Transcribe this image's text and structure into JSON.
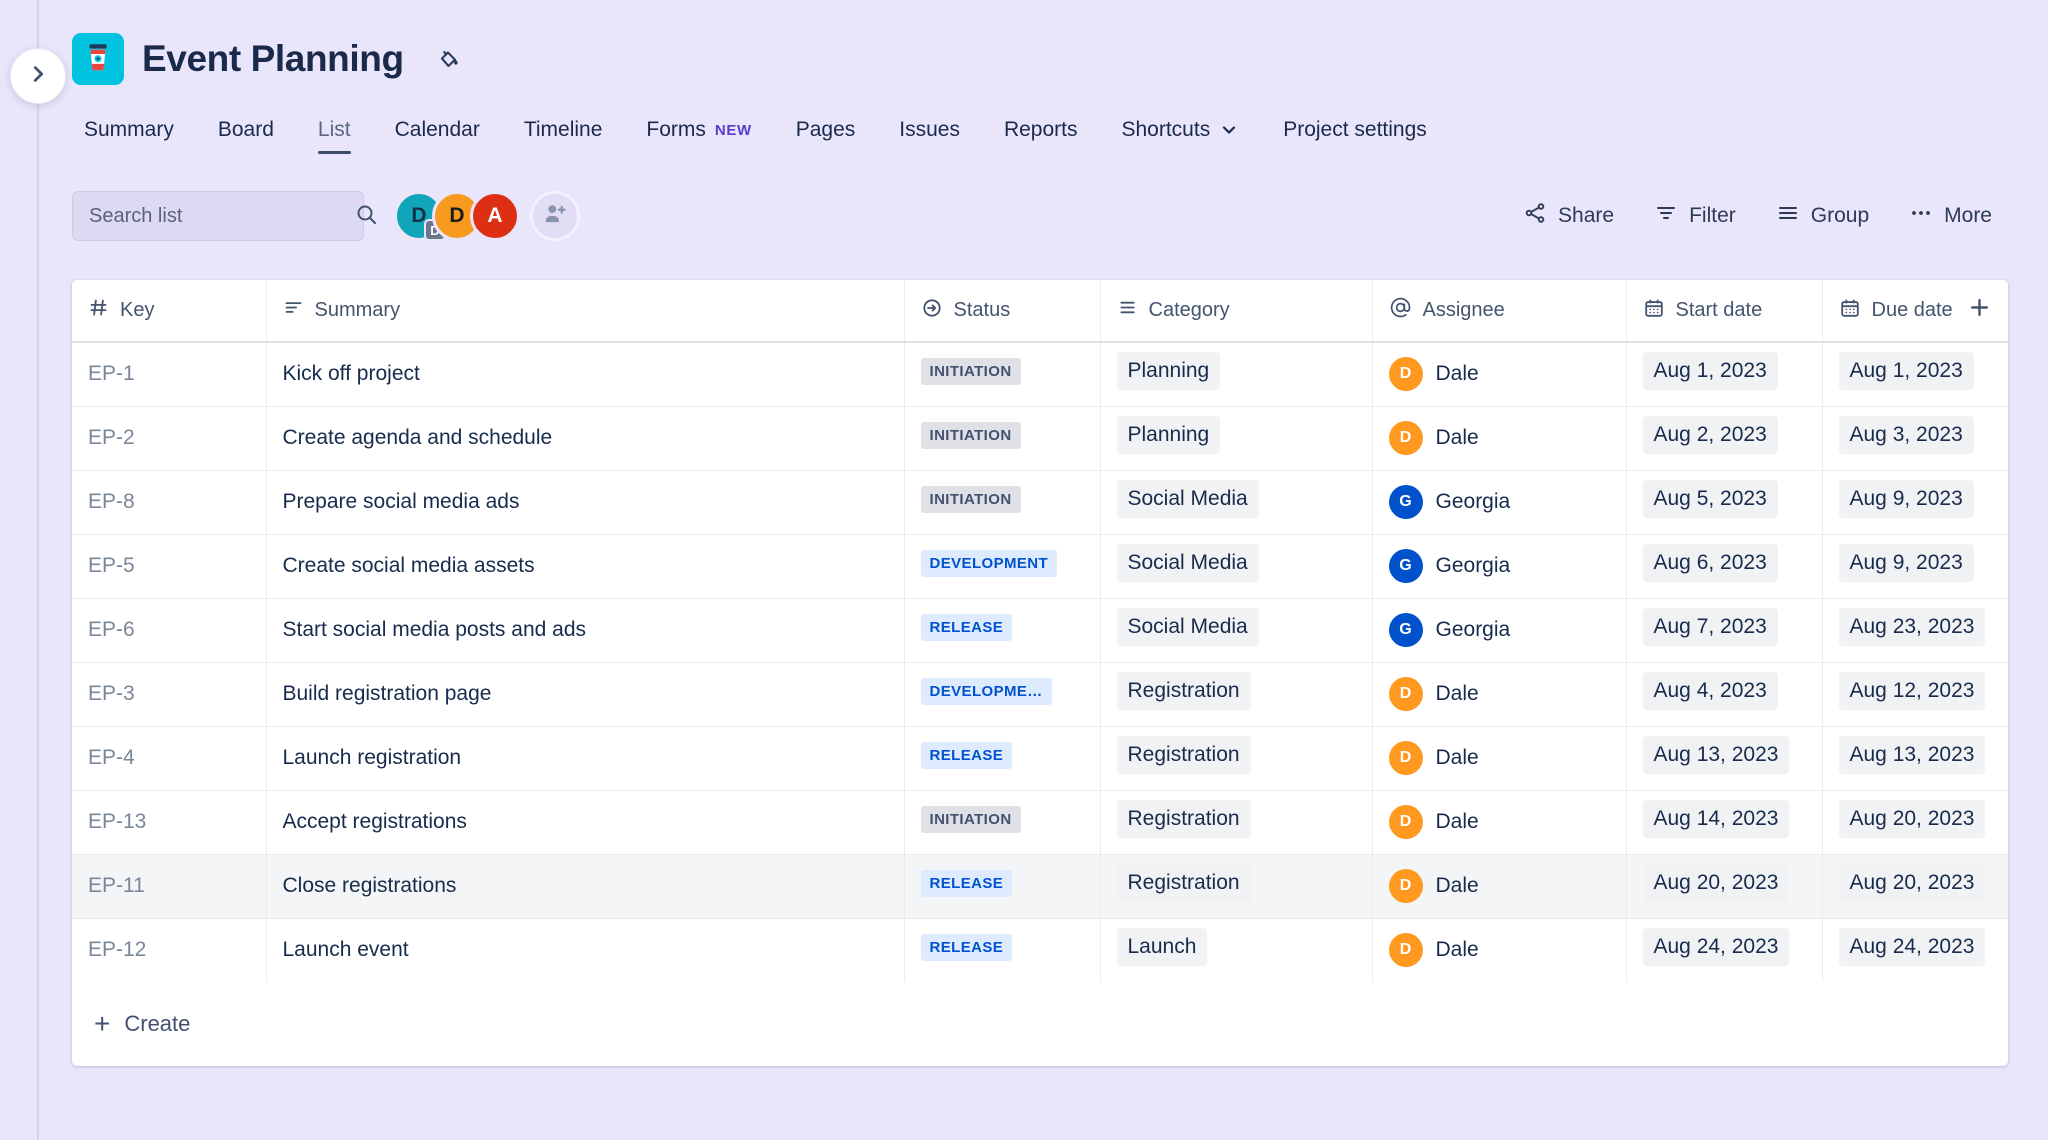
{
  "rail": {
    "expand_icon": "chevron-right-icon"
  },
  "header": {
    "project_icon": "coffee-cup-icon",
    "project_icon_bg": "#00c3e0",
    "title": "Event Planning",
    "paint_icon": "paint-bucket-icon"
  },
  "tabs": [
    {
      "label": "Summary",
      "active": false
    },
    {
      "label": "Board",
      "active": false
    },
    {
      "label": "List",
      "active": true
    },
    {
      "label": "Calendar",
      "active": false
    },
    {
      "label": "Timeline",
      "active": false
    },
    {
      "label": "Forms",
      "active": false,
      "badge": "NEW"
    },
    {
      "label": "Pages",
      "active": false
    },
    {
      "label": "Issues",
      "active": false
    },
    {
      "label": "Reports",
      "active": false
    },
    {
      "label": "Shortcuts",
      "active": false,
      "chevron": "chevron-down-icon"
    },
    {
      "label": "Project settings",
      "active": false
    }
  ],
  "toolbar": {
    "search": {
      "placeholder": "Search list",
      "value": "",
      "icon": "search-icon"
    },
    "avatars": [
      {
        "initial": "D",
        "color": "#12a4b8",
        "sub_initial": "D"
      },
      {
        "initial": "D",
        "color": "#f79a1e"
      },
      {
        "initial": "A",
        "color": "#dd3013"
      }
    ],
    "add_people_icon": "add-person-icon",
    "actions": [
      {
        "label": "Share",
        "icon": "share-icon"
      },
      {
        "label": "Filter",
        "icon": "filter-icon"
      },
      {
        "label": "Group",
        "icon": "group-lines-icon"
      },
      {
        "label": "More",
        "icon": "ellipsis-icon"
      }
    ]
  },
  "table": {
    "columns": [
      {
        "label": "Key",
        "icon": "hash-icon"
      },
      {
        "label": "Summary",
        "icon": "text-lines-icon"
      },
      {
        "label": "Status",
        "icon": "arrow-circle-icon"
      },
      {
        "label": "Category",
        "icon": "list-lines-icon"
      },
      {
        "label": "Assignee",
        "icon": "at-icon"
      },
      {
        "label": "Start date",
        "icon": "calendar-icon"
      },
      {
        "label": "Due date",
        "icon": "calendar-icon"
      }
    ],
    "add_column_icon": "plus-icon",
    "rows": [
      {
        "key": "EP-1",
        "summary": "Kick off project",
        "status": "INITIATION",
        "status_tone": "gray",
        "category": "Planning",
        "assignee": "Dale",
        "assignee_initial": "D",
        "assignee_color": "#ff991f",
        "start": "Aug 1, 2023",
        "due": "Aug 1, 2023",
        "highlight": false
      },
      {
        "key": "EP-2",
        "summary": "Create agenda and schedule",
        "status": "INITIATION",
        "status_tone": "gray",
        "category": "Planning",
        "assignee": "Dale",
        "assignee_initial": "D",
        "assignee_color": "#ff991f",
        "start": "Aug 2, 2023",
        "due": "Aug 3, 2023",
        "highlight": false
      },
      {
        "key": "EP-8",
        "summary": "Prepare social media ads",
        "status": "INITIATION",
        "status_tone": "gray",
        "category": "Social Media",
        "assignee": "Georgia",
        "assignee_initial": "G",
        "assignee_color": "#0052cc",
        "start": "Aug 5, 2023",
        "due": "Aug 9, 2023",
        "highlight": false
      },
      {
        "key": "EP-5",
        "summary": "Create social media assets",
        "status": "DEVELOPMENT",
        "status_tone": "blue",
        "category": "Social Media",
        "assignee": "Georgia",
        "assignee_initial": "G",
        "assignee_color": "#0052cc",
        "start": "Aug 6, 2023",
        "due": "Aug 9, 2023",
        "highlight": false
      },
      {
        "key": "EP-6",
        "summary": "Start social media posts and ads",
        "status": "RELEASE",
        "status_tone": "blue",
        "category": "Social Media",
        "assignee": "Georgia",
        "assignee_initial": "G",
        "assignee_color": "#0052cc",
        "start": "Aug 7, 2023",
        "due": "Aug 23, 2023",
        "highlight": false
      },
      {
        "key": "EP-3",
        "summary": "Build registration page",
        "status": "DEVELOPME…",
        "status_tone": "blue",
        "category": "Registration",
        "assignee": "Dale",
        "assignee_initial": "D",
        "assignee_color": "#ff991f",
        "start": "Aug 4, 2023",
        "due": "Aug 12, 2023",
        "highlight": false
      },
      {
        "key": "EP-4",
        "summary": "Launch registration",
        "status": "RELEASE",
        "status_tone": "blue",
        "category": "Registration",
        "assignee": "Dale",
        "assignee_initial": "D",
        "assignee_color": "#ff991f",
        "start": "Aug 13, 2023",
        "due": "Aug 13, 2023",
        "highlight": false
      },
      {
        "key": "EP-13",
        "summary": "Accept registrations",
        "status": "INITIATION",
        "status_tone": "gray",
        "category": "Registration",
        "assignee": "Dale",
        "assignee_initial": "D",
        "assignee_color": "#ff991f",
        "start": "Aug 14, 2023",
        "due": "Aug 20, 2023",
        "highlight": false
      },
      {
        "key": "EP-11",
        "summary": "Close registrations",
        "status": "RELEASE",
        "status_tone": "blue",
        "category": "Registration",
        "assignee": "Dale",
        "assignee_initial": "D",
        "assignee_color": "#ff991f",
        "start": "Aug 20, 2023",
        "due": "Aug 20, 2023",
        "highlight": true
      },
      {
        "key": "EP-12",
        "summary": "Launch event",
        "status": "RELEASE",
        "status_tone": "blue",
        "category": "Launch",
        "assignee": "Dale",
        "assignee_initial": "D",
        "assignee_color": "#ff991f",
        "start": "Aug 24, 2023",
        "due": "Aug 24, 2023",
        "highlight": false
      }
    ],
    "create_label": "Create",
    "create_icon": "plus-icon"
  }
}
